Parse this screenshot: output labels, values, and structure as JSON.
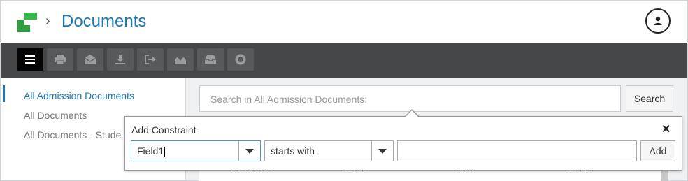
{
  "header": {
    "breadcrumb_separator": "›",
    "title": "Documents",
    "brand_color": "#36b84a",
    "title_color": "#1f78b4"
  },
  "toolbar": {
    "buttons": [
      {
        "name": "menu-icon",
        "active": true
      },
      {
        "name": "print-icon"
      },
      {
        "name": "email-icon"
      },
      {
        "name": "download-icon"
      },
      {
        "name": "export-icon"
      },
      {
        "name": "import-icon"
      },
      {
        "name": "inbox-icon"
      },
      {
        "name": "record-icon"
      }
    ]
  },
  "sidebar": {
    "items": [
      {
        "label": "All Admission Documents",
        "active": true
      },
      {
        "label": "All Documents"
      },
      {
        "label": "All Documents - Stude"
      }
    ]
  },
  "search": {
    "placeholder": "Search in All Admission Documents:",
    "button_label": "Search"
  },
  "table": {
    "partial_row": [
      "F040F7F0",
      "Dallas",
      "Alan",
      "Smith"
    ]
  },
  "constraint": {
    "title": "Add Constraint",
    "close_label": "✕",
    "field_value": "Field1",
    "operator_value": "starts with",
    "value_text": "",
    "add_label": "Add"
  }
}
